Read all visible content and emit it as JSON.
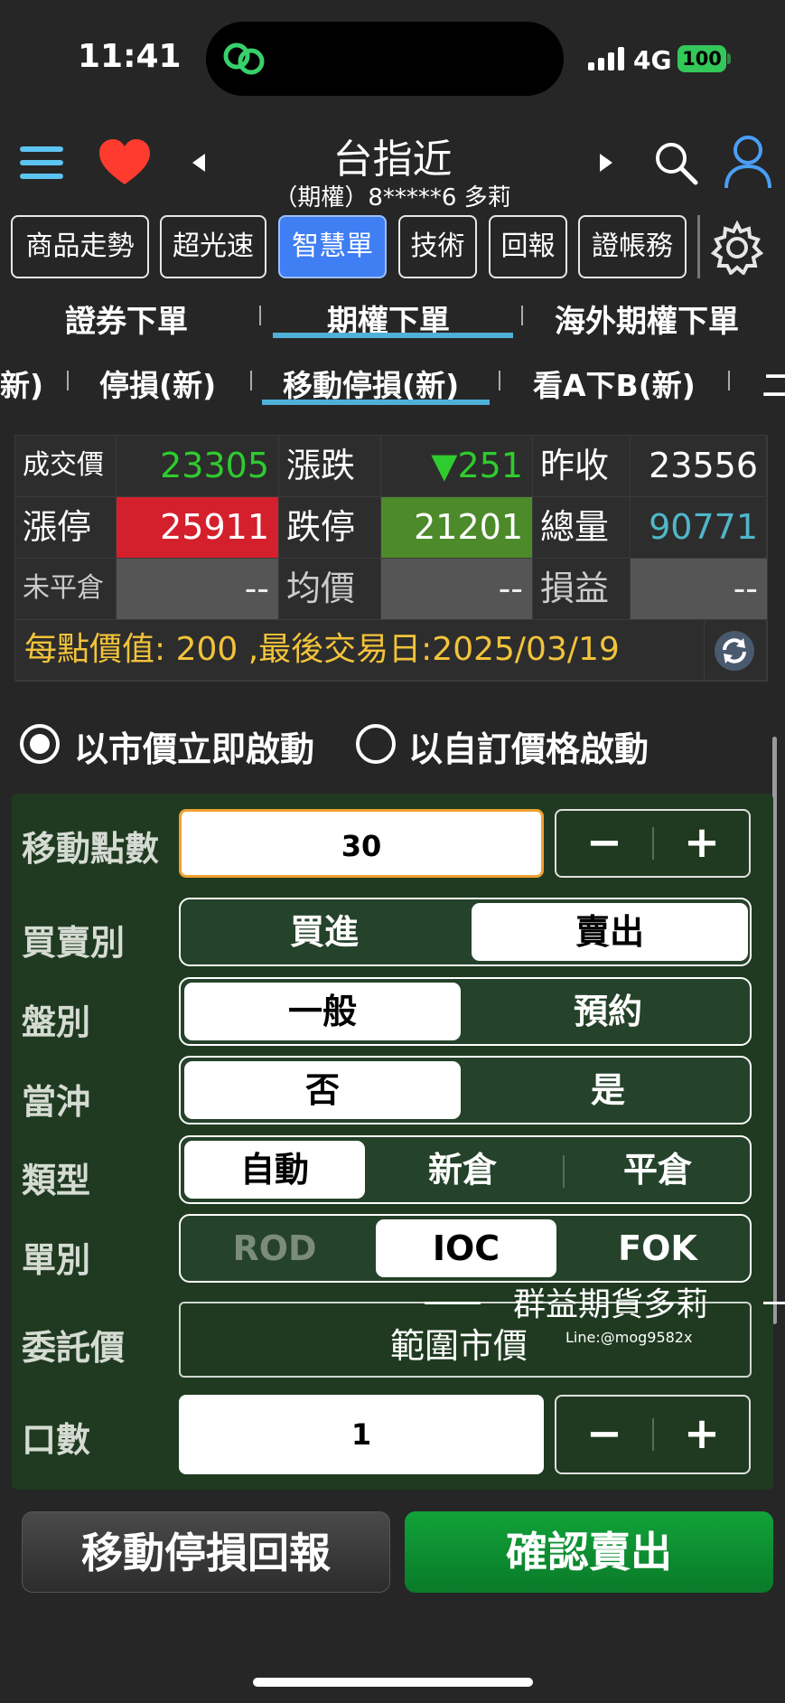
{
  "status": {
    "time": "11:41",
    "network": "4G",
    "battery": "100"
  },
  "header": {
    "title": "台指近",
    "subtitle": "（期權）8*****6  多莉"
  },
  "tabs": [
    {
      "label": "商品走勢"
    },
    {
      "label": "超光速"
    },
    {
      "label": "智慧單"
    },
    {
      "label": "技術"
    },
    {
      "label": "回報"
    },
    {
      "label": "證帳務"
    }
  ],
  "nav_primary": [
    "證券下單",
    "期權下單",
    "海外期權下單"
  ],
  "nav_secondary": [
    "新)",
    "停損(新)",
    "移動停損(新)",
    "看A下B(新)",
    "二"
  ],
  "quote": {
    "last_label": "成交價",
    "last": "23305",
    "change_label": "漲跌",
    "change": "▼251",
    "prev_label": "昨收",
    "prev": "23556",
    "limit_up_label": "漲停",
    "limit_up": "25911",
    "limit_down_label": "跌停",
    "limit_down": "21201",
    "volume_label": "總量",
    "volume": "90771",
    "open_pos_label": "未平倉",
    "open_pos": "--",
    "avg_label": "均價",
    "avg": "--",
    "pnl_label": "損益",
    "pnl": "--",
    "info": "每點價值: 200 ,最後交易日:2025/03/19"
  },
  "colors": {
    "up": "#2ecc2e",
    "limit_up_bg": "#d4202c",
    "limit_down_bg": "#4c8a2a",
    "volume": "#4fb7c9",
    "info": "#f2c33a",
    "confirm_bg": "#0b8a2e"
  },
  "activation": {
    "opt_market": "以市價立即啟動",
    "opt_custom": "以自訂價格啟動"
  },
  "form": {
    "move_points_label": "移動點數",
    "move_points": "30",
    "side_label": "買賣別",
    "buy": "買進",
    "sell": "賣出",
    "session_label": "盤別",
    "session_normal": "一般",
    "session_reserve": "預約",
    "daytrade_label": "當沖",
    "daytrade_no": "否",
    "daytrade_yes": "是",
    "type_label": "類型",
    "type_auto": "自動",
    "type_new": "新倉",
    "type_close": "平倉",
    "order_label": "單別",
    "rod": "ROD",
    "ioc": "IOC",
    "fok": "FOK",
    "price_label": "委託價",
    "price_value": "範圍市價",
    "qty_label": "口數",
    "qty": "1",
    "minus": "−",
    "plus": "+"
  },
  "watermark": {
    "name": "群益期貨多莉",
    "line": "Line:@mog9582x"
  },
  "buttons": {
    "report": "移動停損回報",
    "confirm": "確認賣出"
  }
}
